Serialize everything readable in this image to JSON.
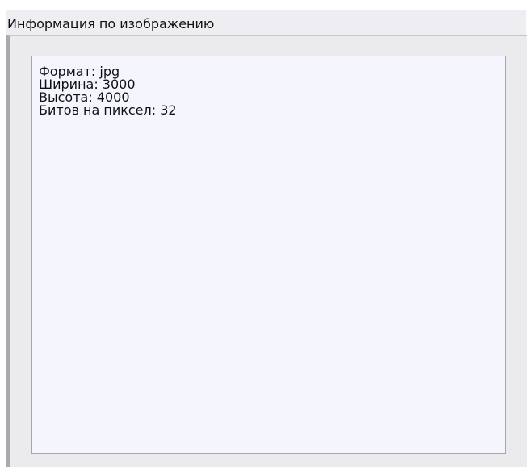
{
  "panel": {
    "title": "Информация по изображению"
  },
  "info": {
    "lines": [
      "Формат: jpg",
      "Ширина: 3000",
      "Высота: 4000",
      "Битов на пиксел: 32"
    ]
  }
}
